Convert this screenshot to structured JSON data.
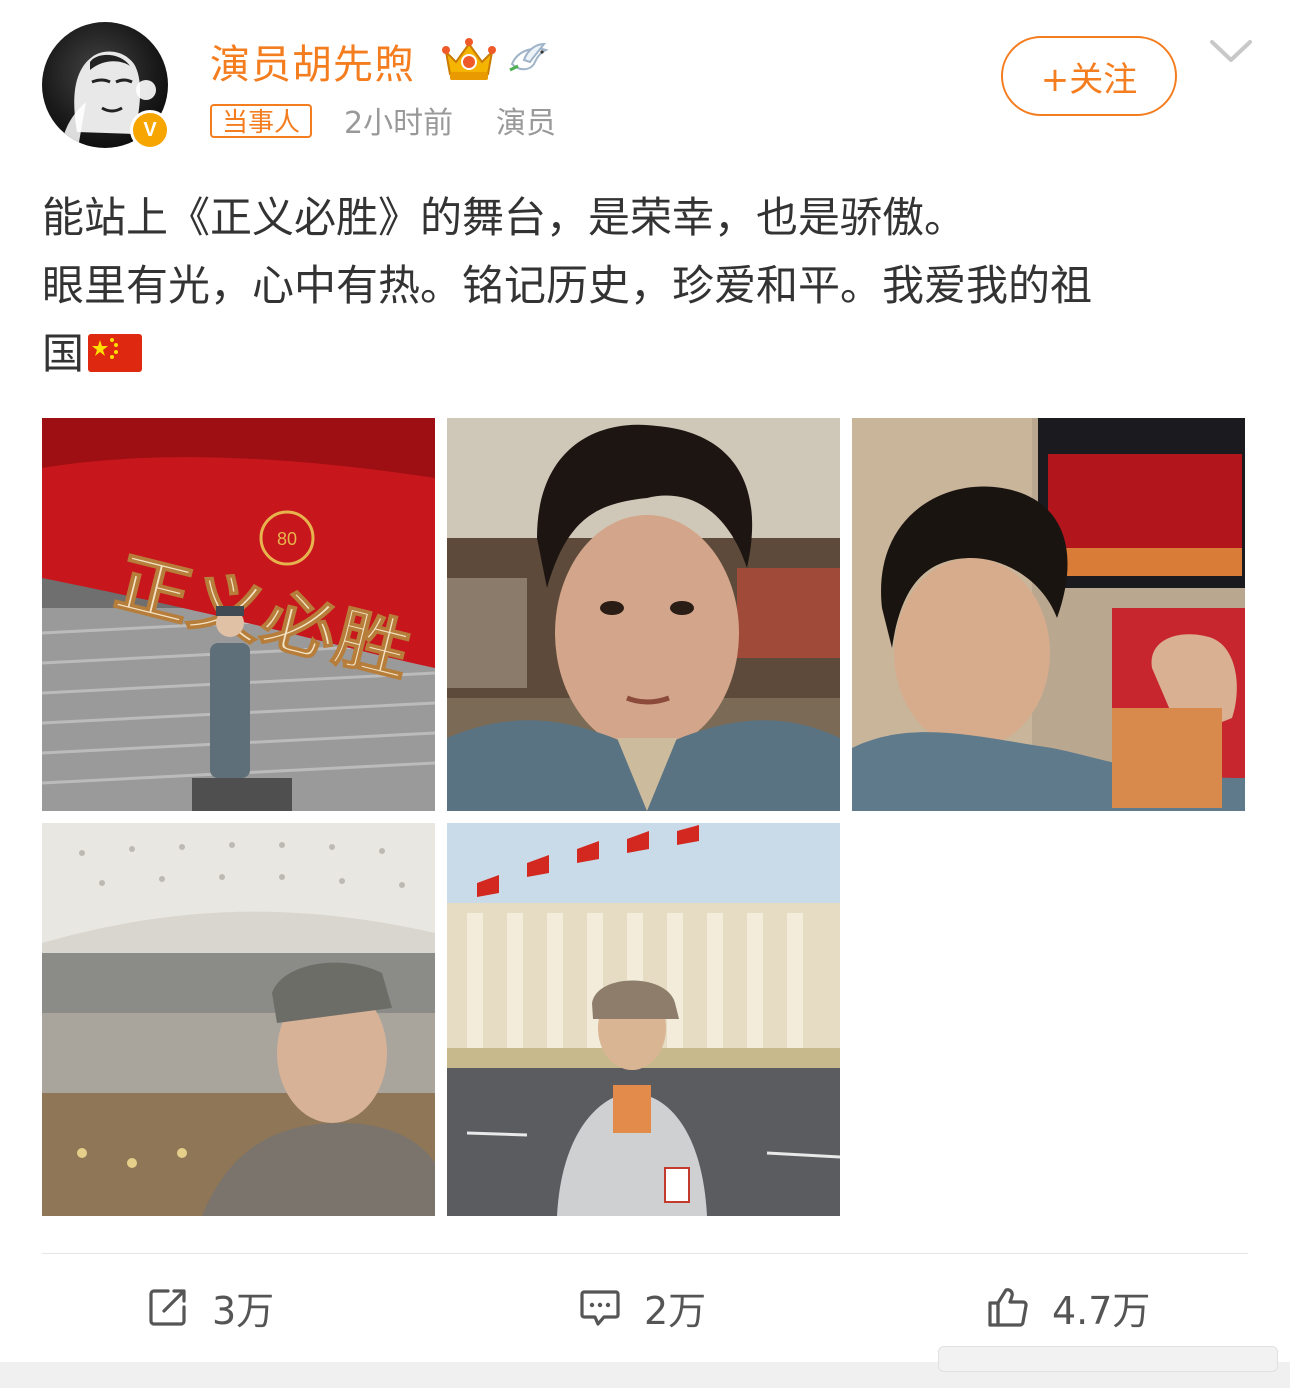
{
  "user": {
    "name": "演员胡先煦",
    "tag": "当事人",
    "time": "2小时前",
    "source": "演员",
    "verified_badge": "V"
  },
  "follow_button": {
    "label": "+关注"
  },
  "post": {
    "line1": "能站上《正义必胜》的舞台，是荣幸，也是骄傲。",
    "line2": "眼里有光，心中有热。铭记历史，珍爱和平。我爱我的祖",
    "line3": "国",
    "flag_icon": "china-flag-emoji"
  },
  "photos": {
    "stage_banner_text": "正义必胜",
    "stage_emblem_text": "80"
  },
  "actions": {
    "repost_count": "3万",
    "comment_count": "2万",
    "like_count": "4.7万"
  },
  "colors": {
    "accent": "#f47d1f",
    "meta_gray": "#999999",
    "badge_gold": "#f7a500"
  },
  "icons": [
    "crown-badge-icon",
    "dove-badge-icon",
    "chevron-down-icon",
    "repost-icon",
    "comment-icon",
    "like-icon"
  ]
}
